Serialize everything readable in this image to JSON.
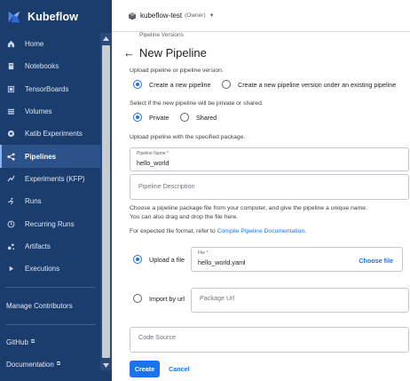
{
  "app": {
    "name": "Kubeflow"
  },
  "sidebar": {
    "items": [
      {
        "label": "Home",
        "icon": "home-icon"
      },
      {
        "label": "Notebooks",
        "icon": "notebook-icon"
      },
      {
        "label": "TensorBoards",
        "icon": "tensorboard-icon"
      },
      {
        "label": "Volumes",
        "icon": "volumes-icon"
      },
      {
        "label": "Katib Experiments",
        "icon": "katib-icon"
      },
      {
        "label": "Pipelines",
        "icon": "pipelines-icon",
        "active": true
      },
      {
        "label": "Experiments (KFP)",
        "icon": "experiments-icon"
      },
      {
        "label": "Runs",
        "icon": "runs-icon"
      },
      {
        "label": "Recurring Runs",
        "icon": "recurring-runs-icon"
      },
      {
        "label": "Artifacts",
        "icon": "artifacts-icon"
      },
      {
        "label": "Executions",
        "icon": "executions-icon"
      }
    ],
    "manage_contributors": "Manage Contributors",
    "github": "GitHub",
    "documentation": "Documentation"
  },
  "topbar": {
    "namespace": "kubeflow-test",
    "owner": "(Owner)"
  },
  "page": {
    "breadcrumb": "Pipeline Versions",
    "title": "New Pipeline",
    "upload_prompt": "Upload pipeline or pipeline version.",
    "radio_create_new": "Create a new pipeline",
    "radio_create_version": "Create a new pipeline version under an existing pipeline",
    "visibility_prompt": "Select if the new pipeline will be private or shared.",
    "radio_private": "Private",
    "radio_shared": "Shared",
    "package_prompt": "Upload pipeline with the specified package.",
    "pipeline_name_label": "Pipeline Name *",
    "pipeline_name_value": "hello_world",
    "pipeline_description_placeholder": "Pipeline Description",
    "choose_text_1": "Choose a pipeline package file from your computer, and give the pipeline a unique name.",
    "choose_text_2": "You can also drag and drop the file here.",
    "format_text": "For expected file format, refer to",
    "format_link": "Compile Pipeline Documentation",
    "format_end": ".",
    "radio_upload_file": "Upload a file",
    "file_label": "File *",
    "file_value": "hello_world.yaml",
    "choose_file": "Choose file",
    "radio_import_url": "Import by url",
    "package_url_placeholder": "Package Url",
    "code_source_placeholder": "Code Source",
    "create_button": "Create",
    "cancel_button": "Cancel"
  },
  "colors": {
    "sidebar_bg": "#1a3d6e",
    "accent": "#1a73e8"
  }
}
